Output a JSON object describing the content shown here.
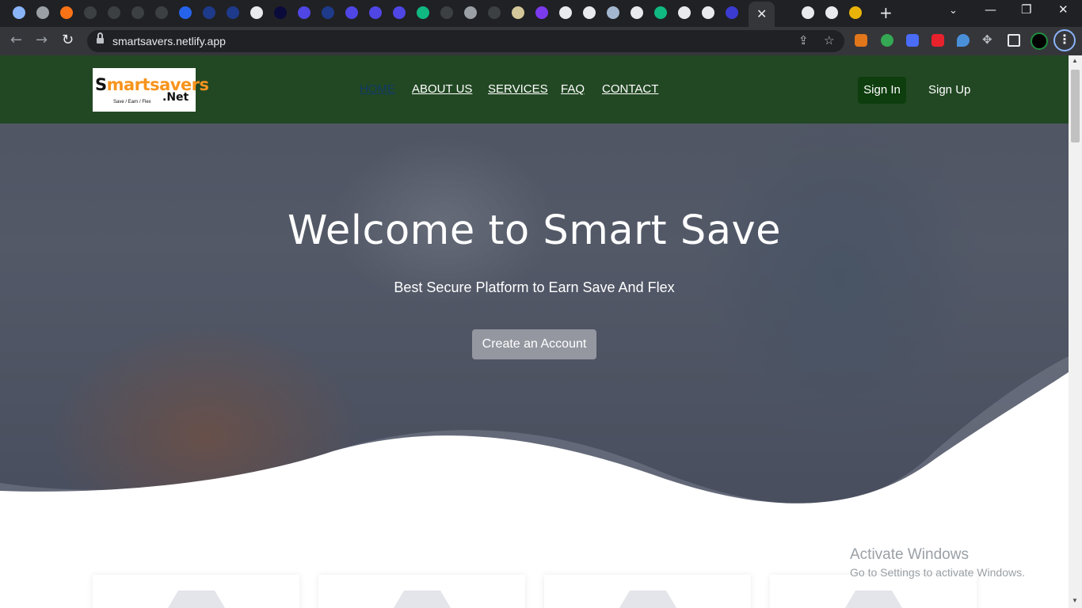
{
  "browser": {
    "tab_close_glyph": "✕",
    "new_tab_glyph": "+",
    "tab_search_glyph": "⌄",
    "window_controls": [
      "—",
      "❐",
      "✕"
    ],
    "back_glyph": "←",
    "forward_glyph": "→",
    "reload_glyph": "↻",
    "url": "smartsavers.netlify.app",
    "share_icon": "share-icon",
    "bookmark_glyph": "☆",
    "menu_glyph": "⋮"
  },
  "site": {
    "logo": {
      "part1": "S",
      "part2": "m",
      "part3": "artsavers",
      "net": ".Net",
      "tagline": "Save / Earn / Flex"
    },
    "nav": [
      "HOME",
      "ABOUT US",
      "SERVICES",
      "FAQ",
      "CONTACT"
    ],
    "sign_in": "Sign In",
    "sign_up": "Sign Up",
    "hero": {
      "title": "Welcome to Smart Save",
      "subtitle": "Best Secure Platform to Earn Save And Flex",
      "cta": "Create an Account"
    }
  },
  "os_watermark": {
    "line1": "Activate Windows",
    "line2": "Go to Settings to activate Windows."
  },
  "colors": {
    "navbar": "#224823",
    "sign_in_bg": "#0e3d0e",
    "logo_orange": "#f7941d"
  }
}
